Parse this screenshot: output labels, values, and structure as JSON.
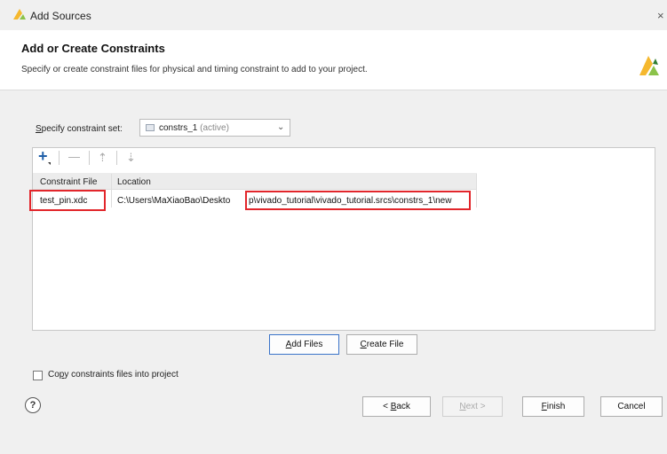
{
  "window": {
    "title": "Add Sources",
    "close_glyph": "×",
    "logo_icon": "vivado-logo-icon"
  },
  "header": {
    "heading": "Add or Create Constraints",
    "description": "Specify or create constraint files for physical and timing constraint to add to your project.",
    "logo_icon": "vivado-logo-icon"
  },
  "constraint_set": {
    "label_first": "S",
    "label_rest": "pecify constraint set:",
    "value": "constrs_1",
    "suffix": "(active)",
    "arrow": "⌄"
  },
  "toolbar": {
    "add": "+",
    "remove": "—",
    "up": "⇡",
    "down": "⇣"
  },
  "table": {
    "columns": [
      "Constraint File",
      "Location"
    ],
    "rows": [
      {
        "file": "test_pin.xdc",
        "location_prefix": "C:\\Users\\MaXiaoBao\\Deskto",
        "location_highlight": "p\\vivado_tutorial\\vivado_tutorial.srcs\\constrs_1\\new"
      }
    ]
  },
  "buttons": {
    "add_files_u": "A",
    "add_files_rest": "dd Files",
    "create_file_u": "C",
    "create_file_rest": "reate File",
    "back_pre": "< ",
    "back_u": "B",
    "back_rest": "ack",
    "next_u": "N",
    "next_rest": "ext >",
    "finish_u": "F",
    "finish_rest": "inish",
    "cancel": "Cancel"
  },
  "copy_option": {
    "label_pre": "Co",
    "label_u": "p",
    "label_rest": "y constraints files into project",
    "checked": false
  },
  "help_glyph": "?",
  "colors": {
    "highlight": "#e2262b",
    "logo": "#f5b82e",
    "focus": "#3b74c9"
  }
}
